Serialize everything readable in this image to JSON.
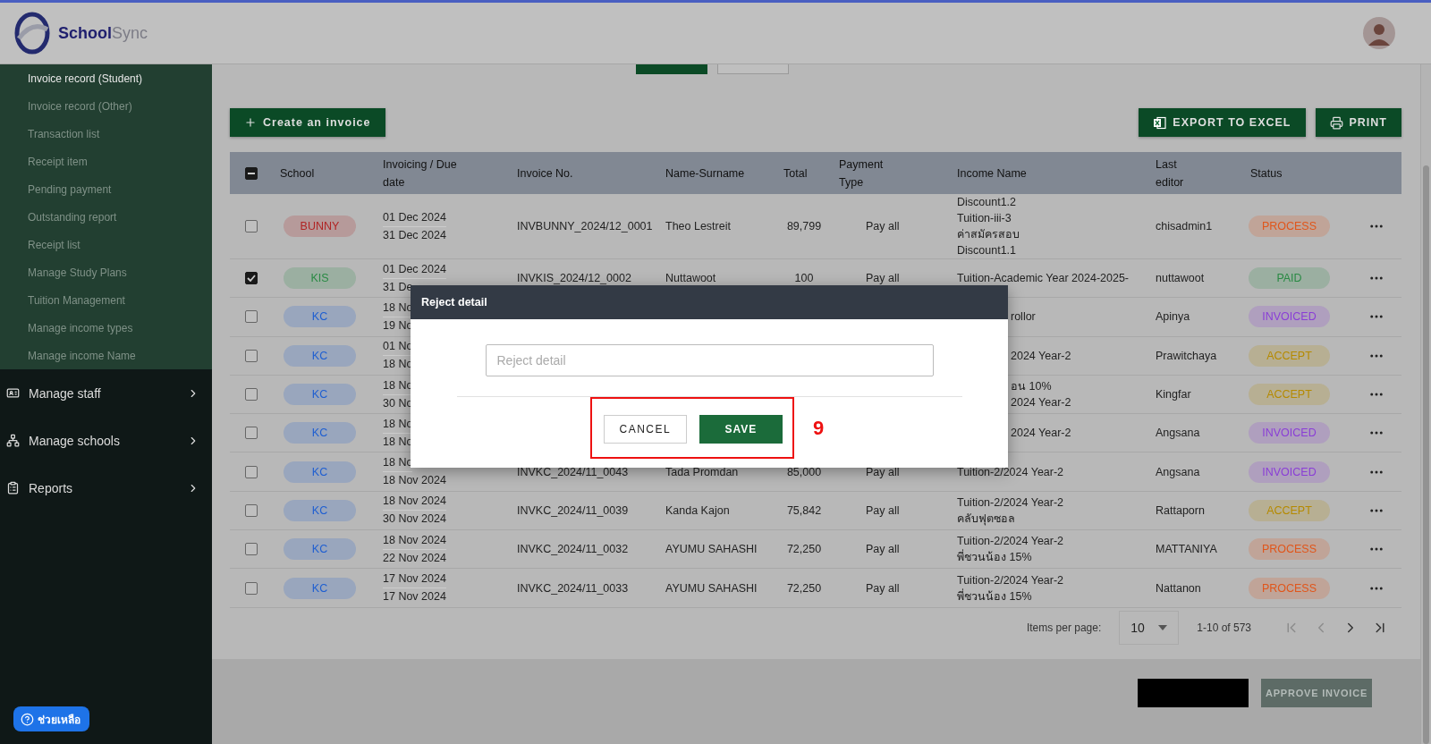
{
  "brand": {
    "name_part_1": "School",
    "name_part_2": "Sync"
  },
  "sidebar": {
    "sub_items": [
      {
        "label": "Invoice record (Student)",
        "selected": true
      },
      {
        "label": "Invoice record (Other)",
        "selected": false
      },
      {
        "label": "Transaction list",
        "selected": false
      },
      {
        "label": "Receipt item",
        "selected": false
      },
      {
        "label": "Pending payment",
        "selected": false
      },
      {
        "label": "Outstanding report",
        "selected": false
      },
      {
        "label": "Receipt list",
        "selected": false
      },
      {
        "label": "Manage Study Plans",
        "selected": false
      },
      {
        "label": "Tuition Management",
        "selected": false
      },
      {
        "label": "Manage income types",
        "selected": false
      },
      {
        "label": "Manage income Name",
        "selected": false
      }
    ],
    "items": [
      {
        "label": "Manage staff",
        "expanded": false
      },
      {
        "label": "Manage schools",
        "expanded": false
      },
      {
        "label": "Reports",
        "expanded": false
      }
    ]
  },
  "toolbar": {
    "create_button": "Create an invoice",
    "export_button": "EXPORT TO EXCEL",
    "print_button": "PRINT"
  },
  "table": {
    "select_all_indeterminate": true,
    "columns": [
      "School",
      "Invoicing / Due date",
      "Invoice No.",
      "Name-Surname",
      "Total",
      "Payment Type",
      "Income Name",
      "Last editor",
      "Status"
    ],
    "rows": [
      {
        "checked": false,
        "school": {
          "label": "BUNNY",
          "color": "#b02424"
        },
        "dates": [
          "01 Dec 2024",
          "31 Dec 2024"
        ],
        "invoice_no": "INVBUNNY_2024/12_0001",
        "name": "Theo Lestreit",
        "total": "89,799",
        "payment_type": "Pay all",
        "income": [
          {
            "text": "Discount1.2"
          },
          {
            "text": "Tuition-iii-3"
          },
          {
            "text": "ค่าสมัครสอบ"
          },
          {
            "text": "Discount1.1"
          }
        ],
        "editor": "chisadmin1",
        "status": {
          "label": "PROCESS",
          "color": "#e0561b"
        }
      },
      {
        "checked": true,
        "school": {
          "label": "KIS",
          "color": "#2a8a44"
        },
        "dates": [
          "01 Dec 2024",
          "31 De"
        ],
        "invoice_no": "INVKIS_2024/12_0002",
        "name": "Nuttawoot",
        "total": "100",
        "payment_type": "Pay all",
        "income": [
          {
            "text": "Tuition-Academic Year 2024-2025-"
          }
        ],
        "editor": "nuttawoot",
        "status": {
          "label": "PAID",
          "color": "#2a8a44"
        }
      },
      {
        "checked": false,
        "school": {
          "label": "KC",
          "color": "#1f5fd1"
        },
        "dates": [
          "18 No",
          "19 No"
        ],
        "income": [
          {
            "text": "rollor",
            "covered_left": true
          }
        ],
        "editor": "Apinya",
        "status": {
          "label": "INVOICED",
          "color": "#8a3ed6"
        }
      },
      {
        "checked": false,
        "school": {
          "label": "KC",
          "color": "#1f5fd1"
        },
        "dates": [
          "01 No",
          "18 No"
        ],
        "income": [
          {
            "text": "2024 Year-2",
            "covered_left": true
          }
        ],
        "editor": "Prawitchaya",
        "status": {
          "label": "ACCEPT",
          "color": "#b58a00"
        }
      },
      {
        "checked": false,
        "school": {
          "label": "KC",
          "color": "#1f5fd1"
        },
        "dates": [
          "18 No",
          "30 No"
        ],
        "income": [
          {
            "text": "อน 10%",
            "covered_left": true
          },
          {
            "text": "2024 Year-2",
            "covered_left": true
          }
        ],
        "editor": "Kingfar",
        "status": {
          "label": "ACCEPT",
          "color": "#b58a00"
        }
      },
      {
        "checked": false,
        "school": {
          "label": "KC",
          "color": "#1f5fd1"
        },
        "dates": [
          "18 No",
          "18 No"
        ],
        "income": [
          {
            "text": "2024 Year-2",
            "covered_left": true
          }
        ],
        "editor": "Angsana",
        "status": {
          "label": "INVOICED",
          "color": "#8a3ed6"
        }
      },
      {
        "checked": false,
        "school": {
          "label": "KC",
          "color": "#1f5fd1"
        },
        "dates": [
          "18 No",
          "18 Nov 2024"
        ],
        "invoice_no": "INVKC_2024/11_0043",
        "name": "Tada Promdan",
        "total": "85,000",
        "payment_type": "Pay all",
        "income": [
          {
            "text": "Tuition-2/2024 Year-2"
          }
        ],
        "editor": "Angsana",
        "status": {
          "label": "INVOICED",
          "color": "#8a3ed6"
        }
      },
      {
        "checked": false,
        "school": {
          "label": "KC",
          "color": "#1f5fd1"
        },
        "dates": [
          "18 Nov 2024",
          "30 Nov 2024"
        ],
        "invoice_no": "INVKC_2024/11_0039",
        "name": "Kanda Kajon",
        "total": "75,842",
        "payment_type": "Pay all",
        "income": [
          {
            "text": "Tuition-2/2024 Year-2"
          },
          {
            "text": "คลับฟุตซอล"
          }
        ],
        "editor": "Rattaporn",
        "status": {
          "label": "ACCEPT",
          "color": "#b58a00"
        }
      },
      {
        "checked": false,
        "school": {
          "label": "KC",
          "color": "#1f5fd1"
        },
        "dates": [
          "18 Nov 2024",
          "22 Nov 2024"
        ],
        "invoice_no": "INVKC_2024/11_0032",
        "name": "AYUMU SAHASHI",
        "total": "72,250",
        "payment_type": "Pay all",
        "income": [
          {
            "text": "Tuition-2/2024 Year-2"
          },
          {
            "text": "พี่ชวนน้อง 15%"
          }
        ],
        "editor": "MATTANIYA",
        "status": {
          "label": "PROCESS",
          "color": "#e0561b"
        }
      },
      {
        "checked": false,
        "school": {
          "label": "KC",
          "color": "#1f5fd1"
        },
        "dates": [
          "17 Nov 2024",
          "17 Nov 2024"
        ],
        "invoice_no": "INVKC_2024/11_0033",
        "name": "AYUMU SAHASHI",
        "total": "72,250",
        "payment_type": "Pay all",
        "income": [
          {
            "text": "Tuition-2/2024 Year-2"
          },
          {
            "text": "พี่ชวนน้อง 15%"
          }
        ],
        "editor": "Nattanon",
        "status": {
          "label": "PROCESS",
          "color": "#e0561b"
        }
      }
    ]
  },
  "pagination": {
    "label": "Items per page:",
    "page_size": "10",
    "range": "1-10 of 573",
    "first_disabled": true,
    "prev_disabled": true,
    "next_disabled": false,
    "last_disabled": false
  },
  "footer": {
    "approve_button": "APPROVE INVOICE",
    "approve_disabled": true
  },
  "dialog": {
    "title": "Reject detail",
    "input_placeholder": "Reject detail",
    "cancel_button": "CANCEL",
    "save_button": "SAVE",
    "annotation": "9"
  },
  "help_button": "ช่วยเหลือ"
}
